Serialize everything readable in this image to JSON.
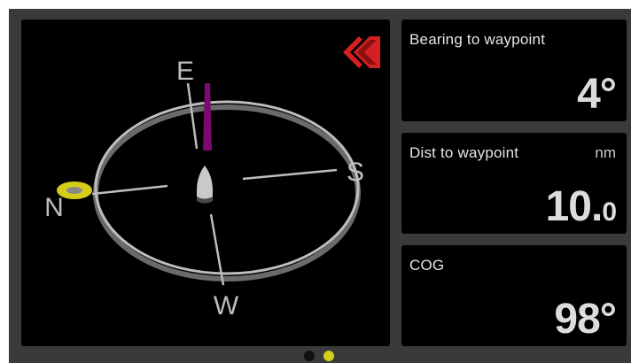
{
  "compass": {
    "cardinals": {
      "north": "N",
      "east": "E",
      "south": "S",
      "west": "W"
    },
    "waypoint_direction_icon": "double-chevron-left-icon",
    "waypoint_color": "#d6cc1a",
    "bearing_needle_color": "#7a0a6e",
    "vessel_icon": "boat-icon"
  },
  "tiles": [
    {
      "label": "Bearing to waypoint",
      "unit": "",
      "value": "4°",
      "value_suffix": ""
    },
    {
      "label": "Dist to waypoint",
      "unit": "nm",
      "value": "10.",
      "value_suffix": "0"
    },
    {
      "label": "COG",
      "unit": "",
      "value": "98°",
      "value_suffix": ""
    }
  ],
  "pager": {
    "page_count": 2,
    "active_page": 2,
    "active_color": "#d6cc1a",
    "inactive_color": "#111111"
  }
}
